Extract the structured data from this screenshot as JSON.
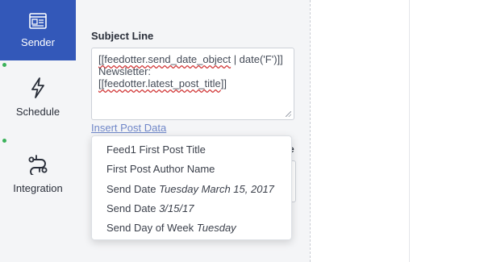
{
  "sidebar": {
    "items": [
      {
        "label": "Sender",
        "icon": "newsletter-icon",
        "active": true
      },
      {
        "label": "Schedule",
        "icon": "lightning-icon",
        "active": false
      },
      {
        "label": "Integration",
        "icon": "integration-icon",
        "active": false
      }
    ]
  },
  "form": {
    "subject_label": "Subject Line",
    "subject_value": {
      "token1": "[[feedotter.send_date_object",
      "part2": " | date('F')]] Newsletter:",
      "token2": "[[feedotter.latest_post_title",
      "part4": "]]"
    },
    "insert_link": "Insert Post Data"
  },
  "dropdown": {
    "items": [
      {
        "label": "Feed1 First Post Title",
        "example": ""
      },
      {
        "label": "First Post Author Name",
        "example": ""
      },
      {
        "label": "Send Date",
        "example": "Tuesday March 15, 2017"
      },
      {
        "label": "Send Date",
        "example": "3/15/17"
      },
      {
        "label": "Send Day of Week",
        "example": "Tuesday"
      }
    ]
  },
  "colors": {
    "accent": "#3358b9",
    "sidebar_bg": "#f4f5f7",
    "link": "#6f86c8",
    "status_dot": "#3bb25a"
  }
}
